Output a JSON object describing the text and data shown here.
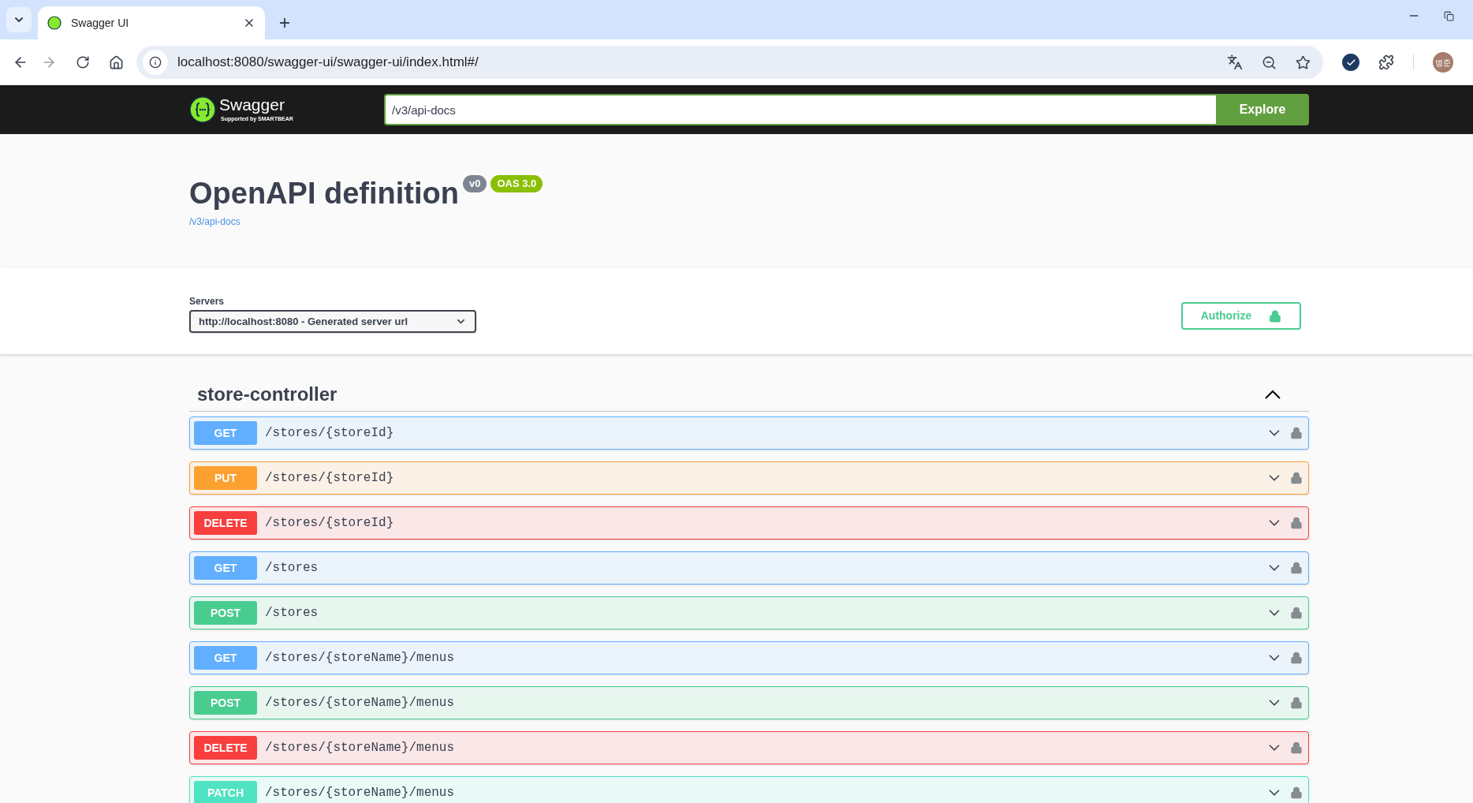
{
  "browser": {
    "tabs": [
      {
        "title": "Swagger UI",
        "selected": true
      }
    ],
    "url": "localhost:8080/swagger-ui/swagger-ui/index.html#/",
    "profile": "병준"
  },
  "topbar": {
    "brand": "Swagger",
    "brand_sub": "Supported by SMARTBEAR",
    "spec_url": "/v3/api-docs",
    "explore": "Explore"
  },
  "info": {
    "title": "OpenAPI definition",
    "version": "v0",
    "oas": "OAS 3.0",
    "link": "/v3/api-docs"
  },
  "servers": {
    "label": "Servers",
    "value": "http://localhost:8080 - Generated server url"
  },
  "authorize": "Authorize",
  "tag": {
    "name": "store-controller",
    "expanded": true
  },
  "operations": [
    {
      "kind": "get",
      "method": "GET",
      "path": "/stores/{storeId}"
    },
    {
      "kind": "put",
      "method": "PUT",
      "path": "/stores/{storeId}"
    },
    {
      "kind": "delete",
      "method": "DELETE",
      "path": "/stores/{storeId}"
    },
    {
      "kind": "get",
      "method": "GET",
      "path": "/stores"
    },
    {
      "kind": "post",
      "method": "POST",
      "path": "/stores"
    },
    {
      "kind": "get",
      "method": "GET",
      "path": "/stores/{storeName}/menus"
    },
    {
      "kind": "post",
      "method": "POST",
      "path": "/stores/{storeName}/menus"
    },
    {
      "kind": "delete",
      "method": "DELETE",
      "path": "/stores/{storeName}/menus"
    },
    {
      "kind": "patch",
      "method": "PATCH",
      "path": "/stores/{storeName}/menus"
    }
  ]
}
